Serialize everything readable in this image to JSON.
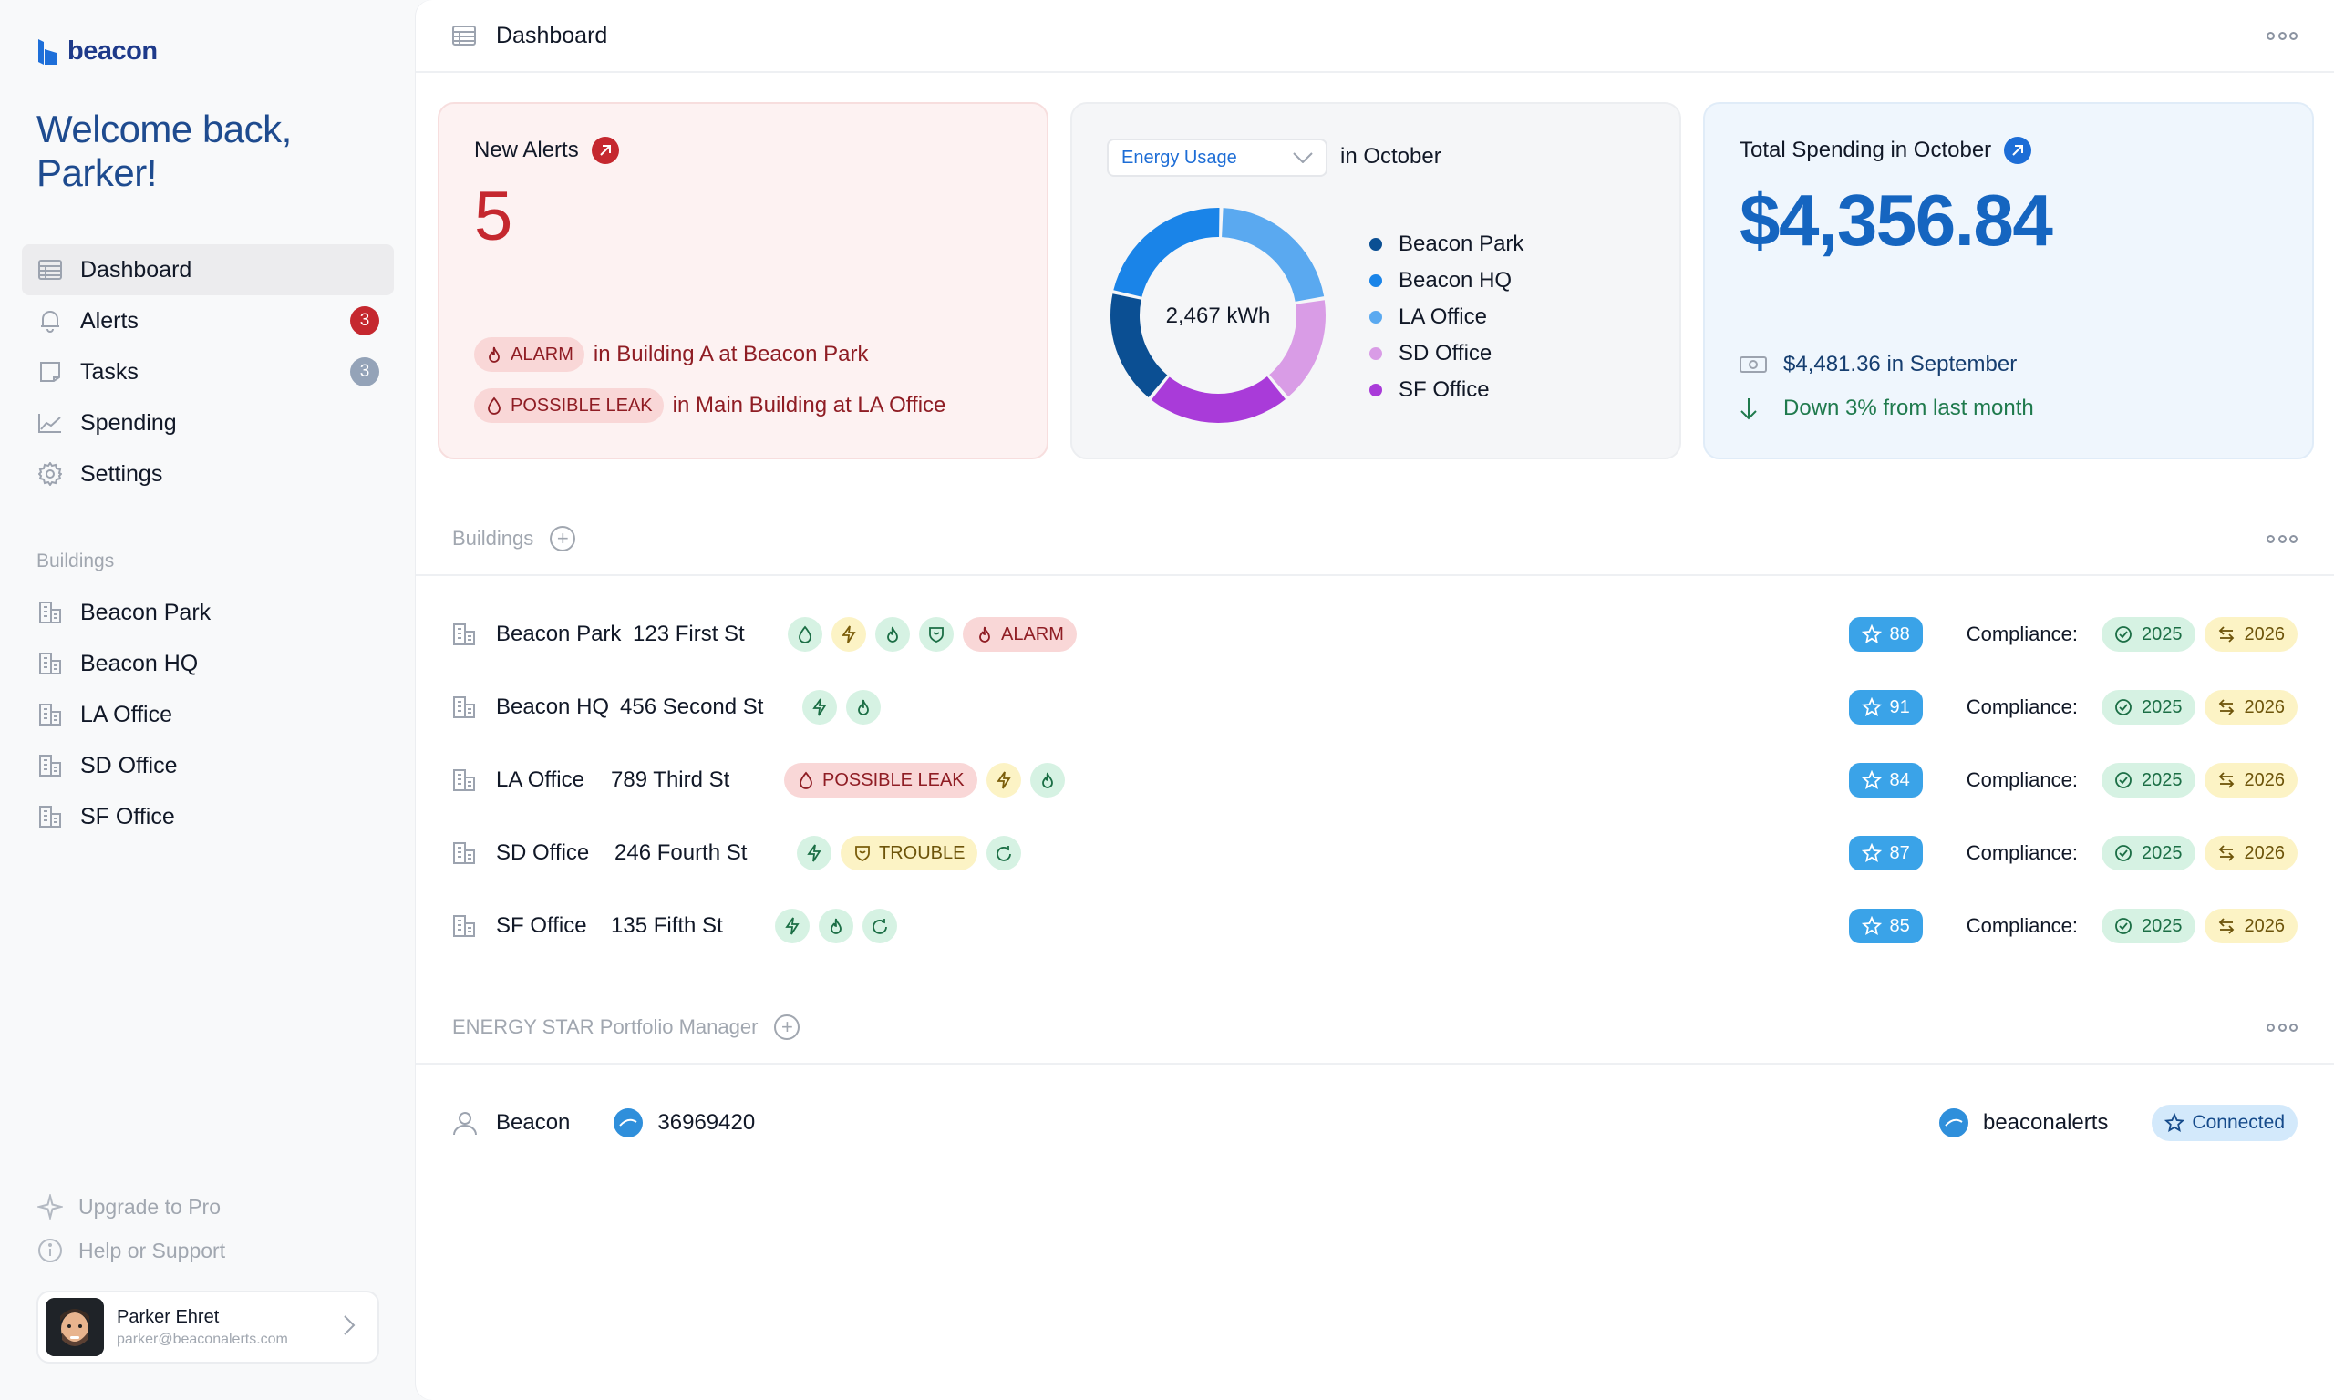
{
  "app": {
    "name": "beacon",
    "welcome": "Welcome back, Parker!"
  },
  "nav": [
    {
      "label": "Dashboard",
      "icon": "dashboard-icon",
      "active": true
    },
    {
      "label": "Alerts",
      "icon": "bell-icon",
      "badge": "3"
    },
    {
      "label": "Tasks",
      "icon": "tasks-icon",
      "badge": "3"
    },
    {
      "label": "Spending",
      "icon": "chart-icon"
    },
    {
      "label": "Settings",
      "icon": "gear-icon"
    }
  ],
  "buildings_nav": {
    "label": "Buildings",
    "items": [
      "Beacon Park",
      "Beacon HQ",
      "LA Office",
      "SD Office",
      "SF Office"
    ]
  },
  "bottom": {
    "upgrade": "Upgrade to Pro",
    "help": "Help or Support"
  },
  "user": {
    "name": "Parker Ehret",
    "email": "parker@beaconalerts.com"
  },
  "topbar": {
    "title": "Dashboard"
  },
  "alerts_card": {
    "title": "New Alerts",
    "count": "5",
    "items": [
      {
        "tag": "ALARM",
        "text": "in Building A at Beacon Park"
      },
      {
        "tag": "POSSIBLE LEAK",
        "text": "in Main Building at LA Office"
      }
    ]
  },
  "energy_card": {
    "select_value": "Energy Usage",
    "period": "in October",
    "center": "2,467 kWh",
    "legend": [
      {
        "name": "Beacon Park",
        "color": "#0b4f93"
      },
      {
        "name": "Beacon HQ",
        "color": "#1a84e8"
      },
      {
        "name": "LA Office",
        "color": "#5aa9f0"
      },
      {
        "name": "SD Office",
        "color": "#d99ce6"
      },
      {
        "name": "SF Office",
        "color": "#a93bd9"
      }
    ],
    "chart_data": {
      "type": "pie",
      "categories": [
        "LA Office",
        "SD Office",
        "SF Office",
        "Beacon Park",
        "Beacon HQ"
      ],
      "values": [
        20,
        15,
        20,
        16,
        20
      ]
    }
  },
  "spend_card": {
    "title": "Total Spending in October",
    "amount": "$4,356.84",
    "previous": "$4,481.36 in September",
    "change": "Down 3% from last month"
  },
  "buildings_section": {
    "title": "Buildings"
  },
  "buildings": [
    {
      "name": "Beacon Park",
      "address": "123 First St",
      "score": "88",
      "tags": [
        {
          "kind": "icon",
          "icon": "water-drop-icon",
          "color": "green"
        },
        {
          "kind": "icon",
          "icon": "bolt-icon",
          "color": "yellow"
        },
        {
          "kind": "icon",
          "icon": "flame-icon",
          "color": "green"
        },
        {
          "kind": "icon",
          "icon": "shield-icon",
          "color": "green"
        },
        {
          "kind": "label",
          "icon": "flame-icon",
          "color": "red",
          "label": "ALARM"
        }
      ]
    },
    {
      "name": "Beacon HQ",
      "address": "456 Second St",
      "score": "91",
      "tags": [
        {
          "kind": "icon",
          "icon": "bolt-icon",
          "color": "green"
        },
        {
          "kind": "icon",
          "icon": "flame-icon",
          "color": "green"
        }
      ]
    },
    {
      "name": "LA Office",
      "address": "789 Third St",
      "score": "84",
      "tags": [
        {
          "kind": "label",
          "icon": "water-drop-icon",
          "color": "red",
          "label": "POSSIBLE LEAK"
        },
        {
          "kind": "icon",
          "icon": "bolt-icon",
          "color": "yellow"
        },
        {
          "kind": "icon",
          "icon": "flame-icon",
          "color": "green"
        }
      ]
    },
    {
      "name": "SD Office",
      "address": "246 Fourth St",
      "score": "87",
      "tags": [
        {
          "kind": "icon",
          "icon": "bolt-icon",
          "color": "green"
        },
        {
          "kind": "label",
          "icon": "shield-icon",
          "color": "yellow",
          "label": "TROUBLE"
        },
        {
          "kind": "icon",
          "icon": "refresh-drop-icon",
          "color": "green"
        }
      ]
    },
    {
      "name": "SF Office",
      "address": "135 Fifth St",
      "score": "85",
      "tags": [
        {
          "kind": "icon",
          "icon": "bolt-icon",
          "color": "green"
        },
        {
          "kind": "icon",
          "icon": "flame-icon",
          "color": "green"
        },
        {
          "kind": "icon",
          "icon": "refresh-drop-icon",
          "color": "green"
        }
      ]
    }
  ],
  "compliance": {
    "label": "Compliance:",
    "year_done": "2025",
    "year_next": "2026"
  },
  "energystar": {
    "title": "ENERGY STAR Portfolio Manager",
    "account": "Beacon",
    "id": "36969420",
    "username": "beaconalerts",
    "status": "Connected"
  }
}
